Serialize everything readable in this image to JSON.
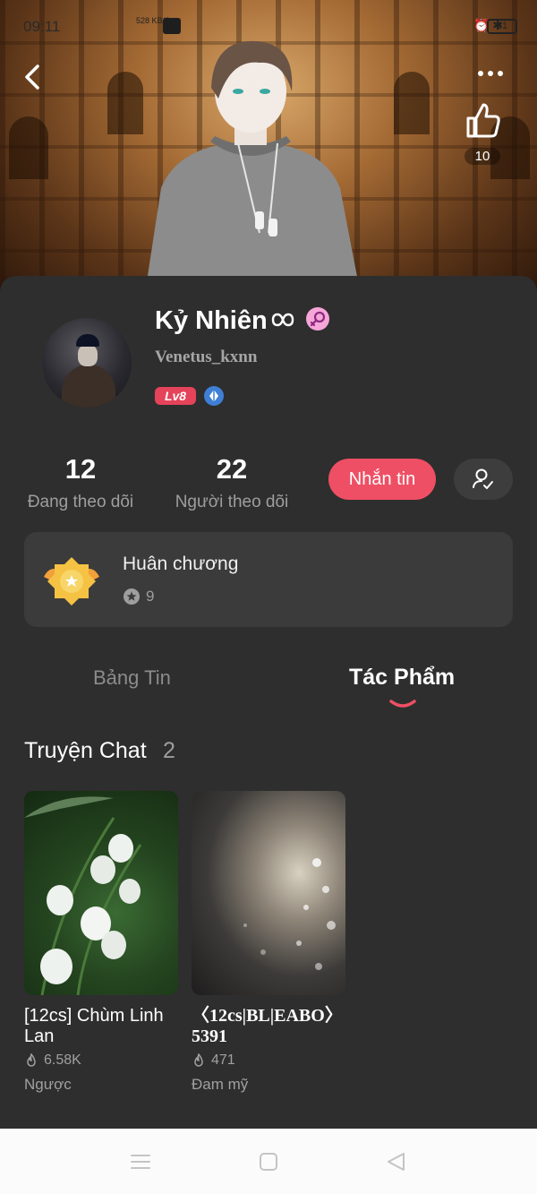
{
  "status_bar": {
    "time": "09:11",
    "network_speed": "528 KB/S",
    "battery": "81"
  },
  "cover": {
    "likes": "10"
  },
  "profile": {
    "display_name": "Kỷ Nhiên",
    "username": "Venetus_kxnn",
    "level": "Lv8",
    "following_count": "12",
    "following_label": "Đang theo dõi",
    "followers_count": "22",
    "followers_label": "Người theo dõi",
    "message_button": "Nhắn tin"
  },
  "medals": {
    "title": "Huân chương",
    "count": "9"
  },
  "tabs": {
    "feed": "Bảng Tin",
    "works": "Tác Phẩm",
    "active": "works"
  },
  "section": {
    "title": "Truyện Chat",
    "count": "2"
  },
  "stories": [
    {
      "title": "[12cs] Chùm Linh Lan",
      "views": "6.58K",
      "genre": "Ngược"
    },
    {
      "title": "〈12cs|BL|EABO〉5391",
      "views": "471",
      "genre": "Đam mỹ"
    }
  ],
  "colors": {
    "accent": "#ef4f64",
    "background": "#2e2e2e",
    "card": "#3b3b3b",
    "muted": "#9e9e9e"
  }
}
